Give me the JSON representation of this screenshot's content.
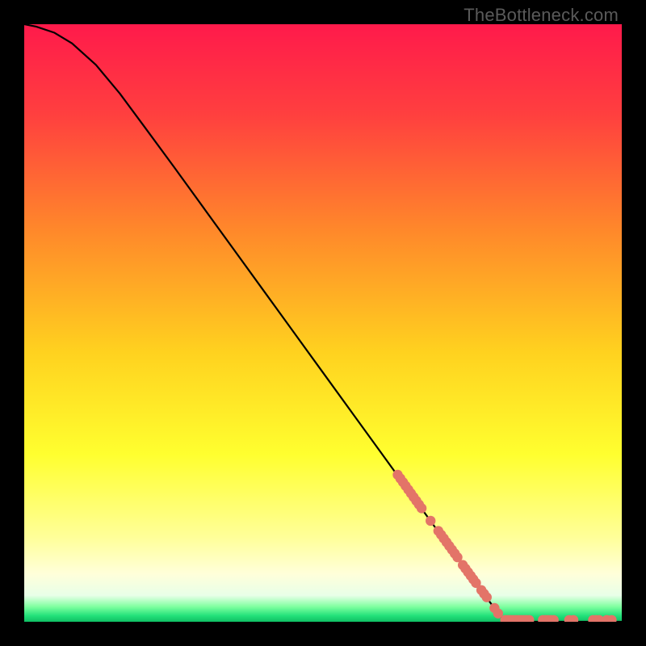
{
  "watermark": "TheBottleneck.com",
  "chart_data": {
    "type": "line",
    "title": "",
    "xlabel": "",
    "ylabel": "",
    "xlim": [
      0,
      100
    ],
    "ylim": [
      0,
      100
    ],
    "grid": false,
    "gradient_stops": [
      {
        "offset": 0.0,
        "color": "#ff1a4b"
      },
      {
        "offset": 0.15,
        "color": "#ff3f3f"
      },
      {
        "offset": 0.35,
        "color": "#ff8a2a"
      },
      {
        "offset": 0.55,
        "color": "#ffd21f"
      },
      {
        "offset": 0.72,
        "color": "#ffff2f"
      },
      {
        "offset": 0.86,
        "color": "#ffff9a"
      },
      {
        "offset": 0.92,
        "color": "#ffffda"
      },
      {
        "offset": 0.956,
        "color": "#e8ffe8"
      },
      {
        "offset": 0.975,
        "color": "#7dff9f"
      },
      {
        "offset": 0.99,
        "color": "#22e17a"
      },
      {
        "offset": 1.0,
        "color": "#0fbf63"
      }
    ],
    "curve": [
      {
        "x": 0.0,
        "y": 100.0
      },
      {
        "x": 2.0,
        "y": 99.6
      },
      {
        "x": 5.0,
        "y": 98.6
      },
      {
        "x": 8.0,
        "y": 96.8
      },
      {
        "x": 12.0,
        "y": 93.2
      },
      {
        "x": 16.0,
        "y": 88.4
      },
      {
        "x": 20.0,
        "y": 83.0
      },
      {
        "x": 25.0,
        "y": 76.2
      },
      {
        "x": 30.0,
        "y": 69.3
      },
      {
        "x": 35.0,
        "y": 62.4
      },
      {
        "x": 40.0,
        "y": 55.5
      },
      {
        "x": 45.0,
        "y": 48.6
      },
      {
        "x": 50.0,
        "y": 41.7
      },
      {
        "x": 55.0,
        "y": 34.8
      },
      {
        "x": 60.0,
        "y": 27.9
      },
      {
        "x": 65.0,
        "y": 21.0
      },
      {
        "x": 70.0,
        "y": 14.1
      },
      {
        "x": 75.0,
        "y": 7.3
      },
      {
        "x": 78.0,
        "y": 3.2
      },
      {
        "x": 79.6,
        "y": 1.0
      },
      {
        "x": 80.5,
        "y": 0.2
      },
      {
        "x": 82.0,
        "y": 0.0
      },
      {
        "x": 100.0,
        "y": 0.0
      }
    ],
    "dot_clusters": {
      "color": "#e37468",
      "radius": 6.2,
      "segments": [
        {
          "x1": 62.5,
          "y1": 24.6,
          "x2": 66.5,
          "y2": 19.0,
          "count": 10
        },
        {
          "x1": 68.0,
          "y1": 16.9,
          "x2": 68.4,
          "y2": 16.4,
          "count": 1
        },
        {
          "x1": 69.3,
          "y1": 15.2,
          "x2": 72.5,
          "y2": 10.8,
          "count": 8
        },
        {
          "x1": 73.4,
          "y1": 9.5,
          "x2": 75.6,
          "y2": 6.5,
          "count": 6
        },
        {
          "x1": 76.5,
          "y1": 5.3,
          "x2": 77.4,
          "y2": 4.1,
          "count": 3
        },
        {
          "x1": 78.7,
          "y1": 2.3,
          "x2": 79.3,
          "y2": 1.4,
          "count": 2
        }
      ],
      "baseline_dots": [
        {
          "x1": 80.5,
          "x2": 84.5,
          "count": 10
        },
        {
          "x1": 86.8,
          "x2": 88.6,
          "count": 5
        },
        {
          "x1": 91.2,
          "x2": 91.9,
          "count": 2
        },
        {
          "x1": 95.2,
          "x2": 96.2,
          "count": 3
        },
        {
          "x1": 97.5,
          "x2": 98.3,
          "count": 2
        }
      ],
      "baseline_y": 0.3
    }
  }
}
